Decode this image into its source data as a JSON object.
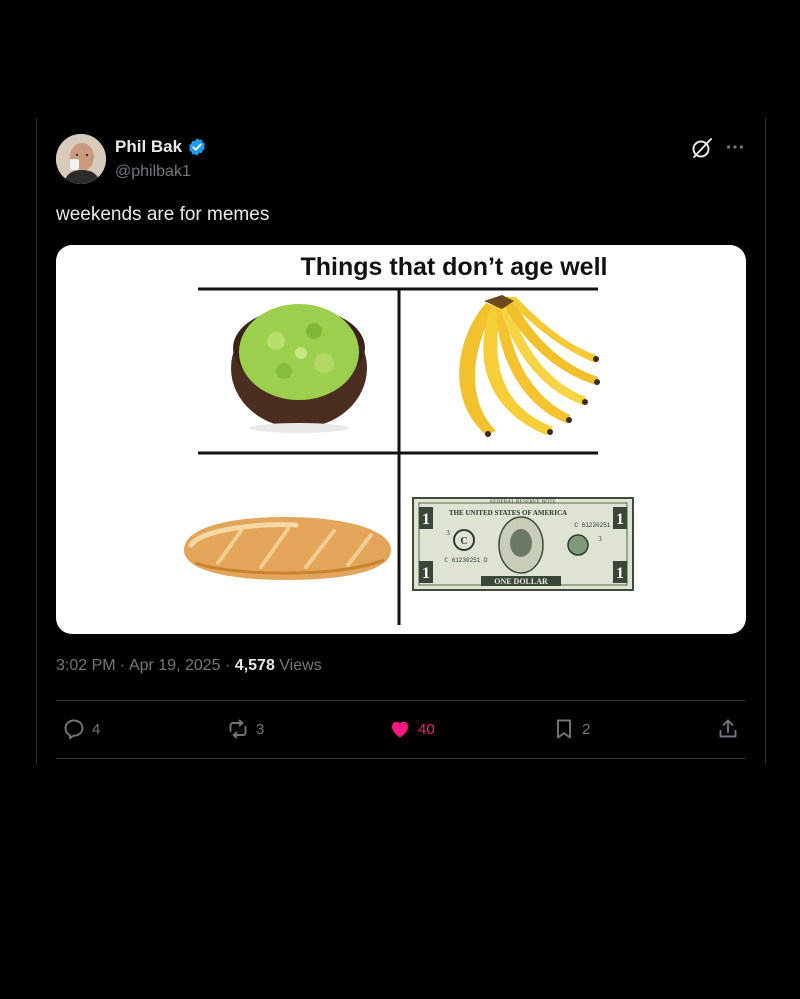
{
  "post": {
    "author_name": "Phil Bak",
    "author_handle": "@philbak1",
    "verified_icon": "verified-badge-icon",
    "text": "weekends are for memes",
    "time": "3:02 PM",
    "date": "Apr 19, 2025",
    "separator": "·",
    "views_count": "4,578",
    "views_label": "Views"
  },
  "meme": {
    "title": "Things that don’t age well",
    "items": [
      "guacamole",
      "bananas",
      "baguette",
      "one dollar bill"
    ],
    "bill": {
      "top_banner": "FEDERAL RESERVE NOTE",
      "country": "THE UNITED STATES OF AMERICA",
      "serial": "C 61230251 D",
      "denomination_text": "ONE DOLLAR",
      "corner_value": "1",
      "seal_letter": "C",
      "district_number": "3"
    }
  },
  "actions": {
    "reply_count": "4",
    "repost_count": "3",
    "like_count": "40",
    "bookmark_count": "2"
  },
  "colors": {
    "background": "#000000",
    "text": "#e7e9ea",
    "muted": "#71767b",
    "divider": "#2f3336",
    "like": "#f91880",
    "verified": "#1d9bf0"
  }
}
